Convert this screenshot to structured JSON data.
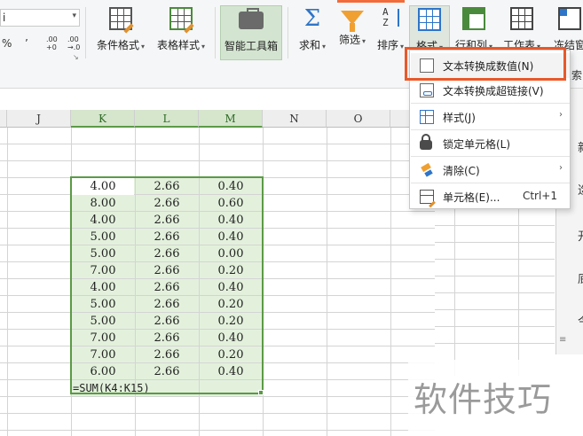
{
  "ribbon": {
    "font_value": "i",
    "numfmt": {
      "percent": "%",
      "comma": "’",
      "inc_dec": ".00",
      "dec_sub": "+0",
      "dec_inc": ".00",
      "dec_inc_sub": "→.0"
    },
    "buttons": [
      {
        "id": "conditional-format",
        "label": "条件格式",
        "icon": "conditional-format-icon"
      },
      {
        "id": "table-style",
        "label": "表格样式",
        "icon": "table-style-icon"
      },
      {
        "id": "smart-toolbox",
        "label": "智能工具箱",
        "icon": "toolbox-icon"
      },
      {
        "id": "sum",
        "label": "求和",
        "icon": "sigma-icon"
      },
      {
        "id": "filter",
        "label": "筛选",
        "icon": "filter-icon"
      },
      {
        "id": "sort",
        "label": "排序",
        "icon": "sort-icon"
      },
      {
        "id": "format",
        "label": "格式",
        "icon": "format-icon"
      },
      {
        "id": "rows-cols",
        "label": "行和列",
        "icon": "rows-cols-icon"
      },
      {
        "id": "worksheet",
        "label": "工作表",
        "icon": "worksheet-icon"
      },
      {
        "id": "freeze",
        "label": "冻结窗",
        "icon": "freeze-icon"
      }
    ],
    "dropdown_arrow": "▾",
    "search_fragment": "搜索"
  },
  "sheet": {
    "columns": [
      "J",
      "K",
      "L",
      "M",
      "N",
      "O"
    ],
    "rows": [
      [
        "4.00",
        "2.66",
        "0.40"
      ],
      [
        "8.00",
        "2.66",
        "0.60"
      ],
      [
        "4.00",
        "2.66",
        "0.40"
      ],
      [
        "5.00",
        "2.66",
        "0.40"
      ],
      [
        "5.00",
        "2.66",
        "0.00"
      ],
      [
        "7.00",
        "2.66",
        "0.20"
      ],
      [
        "4.00",
        "2.66",
        "0.40"
      ],
      [
        "5.00",
        "2.66",
        "0.20"
      ],
      [
        "5.00",
        "2.66",
        "0.20"
      ],
      [
        "7.00",
        "2.66",
        "0.40"
      ],
      [
        "7.00",
        "2.66",
        "0.20"
      ],
      [
        "6.00",
        "2.66",
        "0.40"
      ]
    ],
    "formula_cell": "=SUM(K4:K15)"
  },
  "menu": {
    "items": [
      {
        "label": "文本转换成数值(N)",
        "icon": "text-to-number-icon",
        "chevron": "",
        "shortcut": ""
      },
      {
        "label": "文本转换成超链接(V)",
        "icon": "text-to-hyperlink-icon",
        "chevron": "",
        "shortcut": ""
      },
      {
        "label": "样式(J)",
        "icon": "style-icon",
        "chevron": "›",
        "shortcut": ""
      },
      {
        "label": "锁定单元格(L)",
        "icon": "lock-icon",
        "chevron": "",
        "shortcut": ""
      },
      {
        "label": "清除(C)",
        "icon": "eraser-icon",
        "chevron": "›",
        "shortcut": ""
      },
      {
        "label": "单元格(E)...",
        "icon": "cell-format-icon",
        "chevron": "",
        "shortcut": "Ctrl+1"
      }
    ]
  },
  "sidebar": {
    "chars": [
      "新",
      "迄",
      "〈",
      "开",
      "底",
      "今"
    ]
  },
  "watermark": {
    "text": "软件技巧"
  },
  "colors": {
    "accent": "#f26b3a",
    "highlight_box": "#e8582a",
    "selection": "#5b9a45",
    "selection_fill": "#e3f1dc"
  }
}
